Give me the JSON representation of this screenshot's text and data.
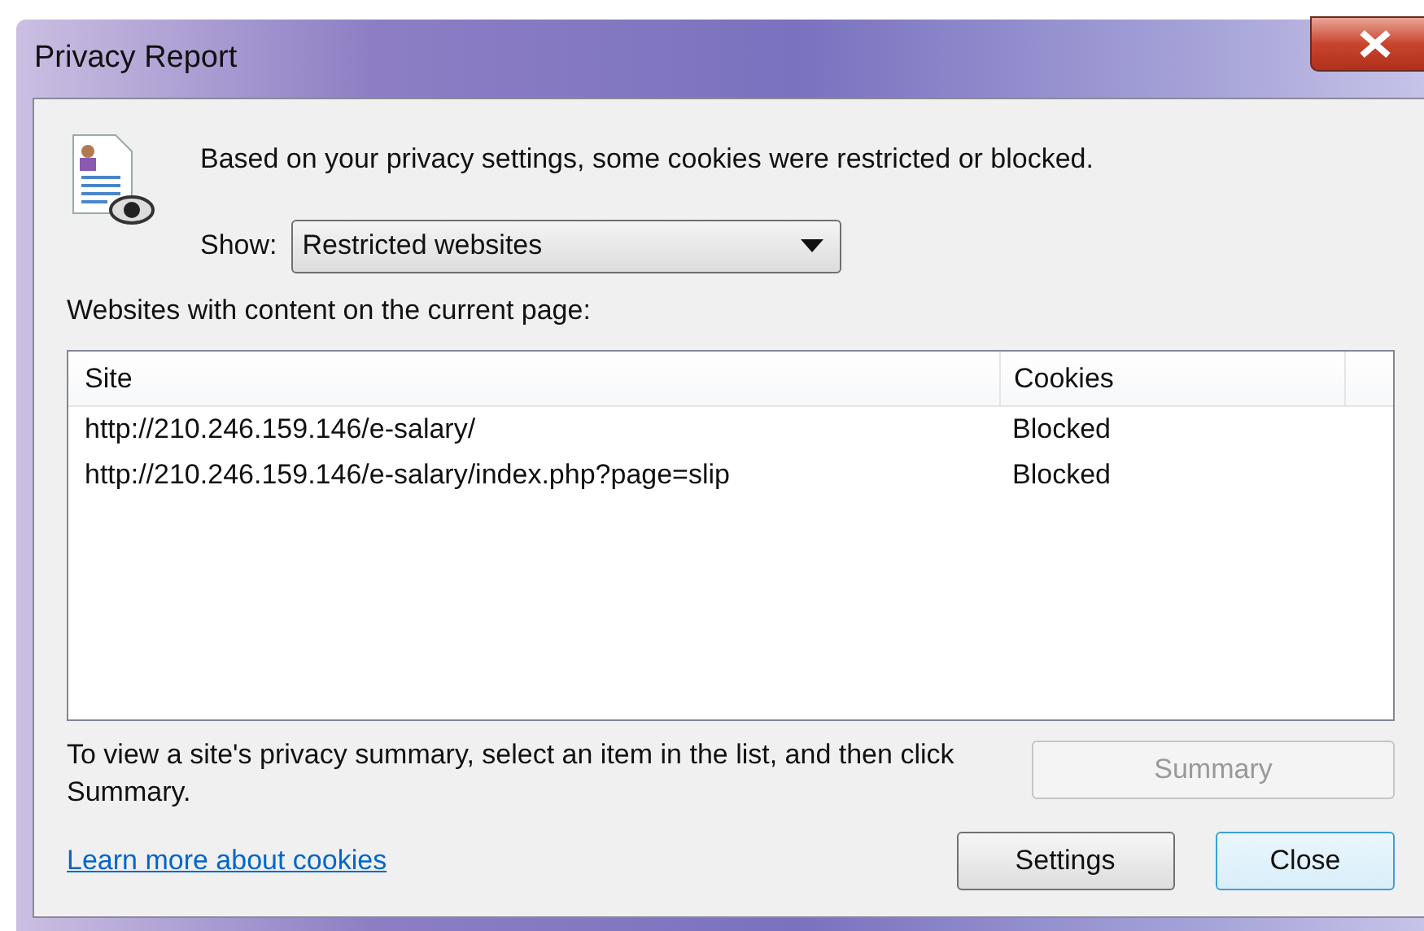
{
  "window": {
    "title": "Privacy Report"
  },
  "message": "Based on your privacy settings, some cookies were restricted or blocked.",
  "show": {
    "label": "Show:",
    "value": "Restricted websites"
  },
  "list_caption": "Websites with content on the current page:",
  "table": {
    "columns": [
      "Site",
      "Cookies"
    ],
    "rows": [
      {
        "site": "http://210.246.159.146/e-salary/",
        "cookies": "Blocked",
        "selected": false
      },
      {
        "site": "http://210.246.159.146/e-salary/index.php?page=slip",
        "cookies": "Blocked",
        "selected": false
      }
    ]
  },
  "hint": "To view a site's privacy summary, select an item in the list, and then click Summary.",
  "summary_button": {
    "label": "Summary",
    "disabled": true
  },
  "link": "Learn more about cookies",
  "buttons": [
    {
      "label": "Settings",
      "default": false
    },
    {
      "label": "Close",
      "default": true
    }
  ]
}
